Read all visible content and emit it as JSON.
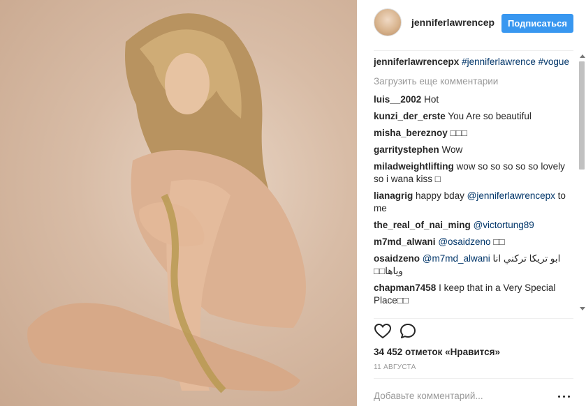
{
  "post": {
    "image_alt": "",
    "author": "jenniferlawrencep",
    "follow_label": "Подписаться",
    "caption": {
      "user": "jenniferlawrencepx",
      "tags": [
        "#jenniferlawrence",
        "#vogue"
      ]
    },
    "load_more": "Загрузить еще комментарии",
    "comments": [
      {
        "user": "luis__2002",
        "text": "Hot"
      },
      {
        "user": "kunzi_der_erste",
        "text": "You Are so beautiful"
      },
      {
        "user": "misha_bereznoy",
        "text": "□□□"
      },
      {
        "user": "garritystephen",
        "text": "Wow"
      },
      {
        "user": "miladweightlifting",
        "text": "wow so so so so so lovely so i wana kiss □"
      },
      {
        "user": "lianagrig",
        "text": "happy bday",
        "mention": "@jenniferlawrencepx",
        "after": "to me"
      },
      {
        "user": "the_real_of_nai_ming",
        "mention": "@victortung89"
      },
      {
        "user": "m7md_alwani",
        "mention": "@osaidzeno",
        "after": "□□"
      },
      {
        "user": "osaidzeno",
        "mention": "@m7md_alwani",
        "after": "ابو تريكا تركني انا وياها□□"
      },
      {
        "user": "chapman7458",
        "text": "I keep that in a Very Special Place□□"
      }
    ],
    "likes": "34 452 отметок «Нравится»",
    "date": "11 АВГУСТА",
    "add_comment_placeholder": "Добавьте комментарий..."
  },
  "colors": {
    "accent": "#3897f0",
    "hashtag": "#003569",
    "muted": "#999999"
  },
  "icons": [
    "heart-icon",
    "comment-icon",
    "more-options-icon"
  ]
}
